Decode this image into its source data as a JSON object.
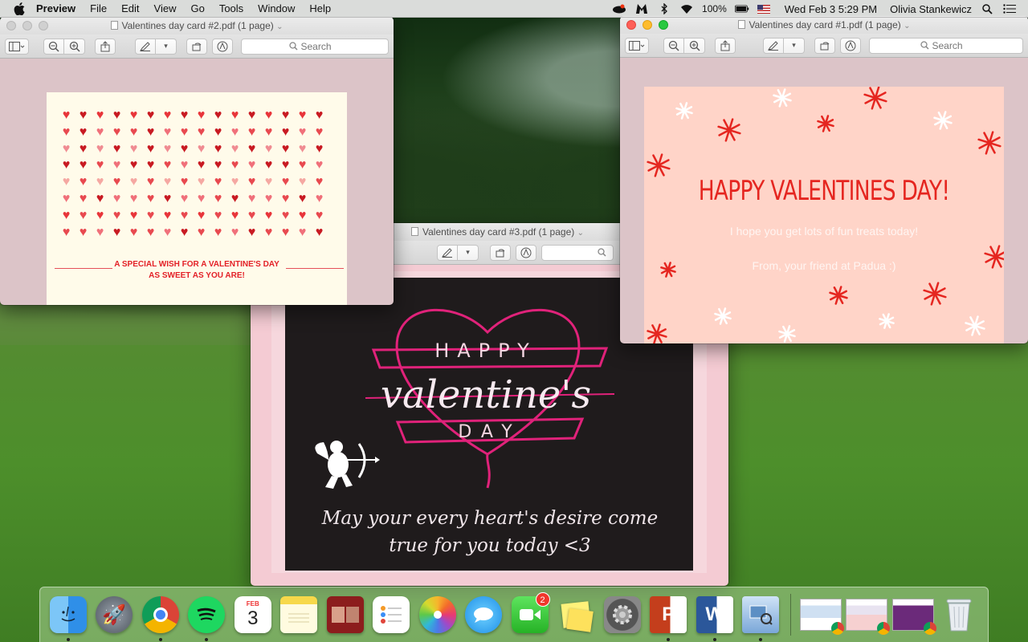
{
  "menubar": {
    "app_name": "Preview",
    "menus": [
      "File",
      "Edit",
      "View",
      "Go",
      "Tools",
      "Window",
      "Help"
    ],
    "battery": "100%",
    "datetime": "Wed Feb 3  5:29 PM",
    "user": "Olivia Stankewicz"
  },
  "windows": {
    "card2": {
      "title": "Valentines day card #2.pdf (1 page)",
      "search_placeholder": "Search",
      "card_text_line1": "A SPECIAL WISH FOR A VALENTINE'S DAY",
      "card_text_line2": "AS SWEET AS YOU ARE!",
      "heart_colors": [
        "#e8353a",
        "#f0707a",
        "#f5a8a2",
        "#c81a22",
        "#f08c92",
        "#e8494f"
      ]
    },
    "card3": {
      "title": "Valentines day card #3.pdf (1 page)",
      "card_happy": "HAPPY",
      "card_valentine": "valentine's",
      "card_day": "DAY",
      "message_line1": "May your every heart's desire come",
      "message_line2": "true for you today <3"
    },
    "card1": {
      "title": "Valentines day card #1.pdf (1 page)",
      "search_placeholder": "Search",
      "card_title": "HAPPY VALENTINES DAY!",
      "card_line1": "I hope you get lots of fun treats today!",
      "card_line2": "From, your friend at Padua :)"
    }
  },
  "dock": {
    "calendar_month": "FEB",
    "calendar_day": "3",
    "facetime_badge": "2",
    "items": [
      "Finder",
      "Launchpad",
      "Google Chrome",
      "Spotify",
      "Calendar",
      "Notes",
      "Photo Booth",
      "Reminders",
      "Photos",
      "Messages",
      "FaceTime",
      "Stickies",
      "System Preferences",
      "Microsoft PowerPoint",
      "Microsoft Word",
      "Preview",
      "Trash"
    ]
  }
}
